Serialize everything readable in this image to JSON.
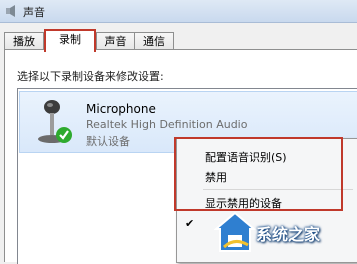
{
  "window": {
    "title": "声音"
  },
  "tabs": [
    {
      "label": "播放",
      "active": false
    },
    {
      "label": "录制",
      "active": true
    },
    {
      "label": "声音",
      "active": false
    },
    {
      "label": "通信",
      "active": false
    }
  ],
  "panel": {
    "instruction": "选择以下录制设备来修改设置:"
  },
  "device": {
    "name": "Microphone",
    "driver": "Realtek High Definition Audio",
    "status": "默认设备",
    "icon": "microphone-icon",
    "status_icon": "green-check-icon"
  },
  "context_menu": {
    "items": [
      {
        "label": "配置语音识别(S)"
      },
      {
        "label": "禁用"
      },
      {
        "label": "显示禁用的设备"
      }
    ]
  },
  "watermark": {
    "text": "系统之家"
  },
  "colors": {
    "highlight_outline": "#c0392b",
    "selection": "#d9e8fa",
    "watermark_blue": "#1b4f8c"
  }
}
